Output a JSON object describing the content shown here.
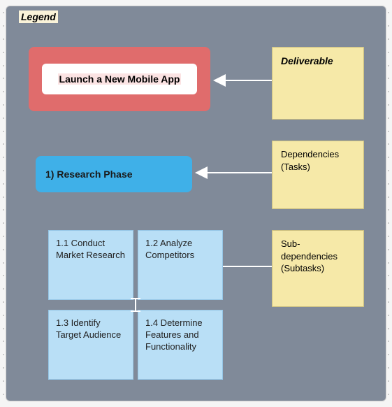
{
  "legend_title": "Legend",
  "deliverable": {
    "label": "Launch a New Mobile App"
  },
  "task": {
    "label": "1) Research Phase"
  },
  "subtasks": {
    "s11": "1.1 Conduct Market Research",
    "s12": "1.2 Analyze Competitors",
    "s13": "1.3 Identify Target Audience",
    "s14": "1.4 Determine Features and Functionality"
  },
  "notes": {
    "deliverable": "Deliverable",
    "dependencies": "Dependencies (Tasks)",
    "subdependencies": "Sub-dependencies (Subtasks)"
  },
  "colors": {
    "canvas": "#808a99",
    "deliverable_border": "#e06c6c",
    "task": "#3fb0e8",
    "subtask": "#b9dff6",
    "note": "#f6e9a8"
  }
}
